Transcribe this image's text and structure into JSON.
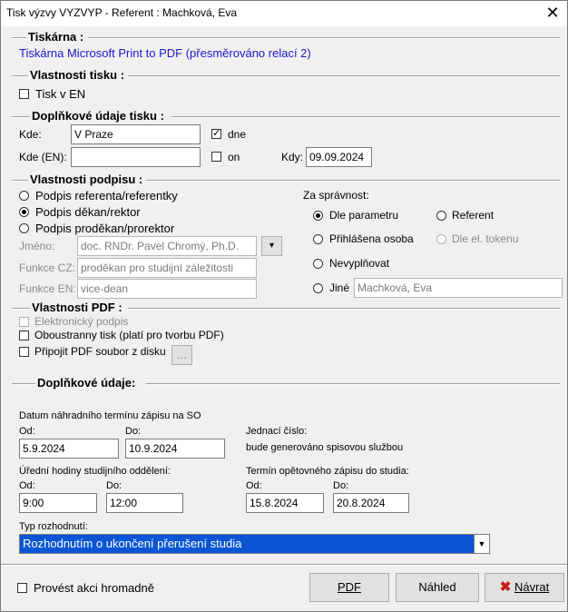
{
  "window": {
    "title": "Tisk výzvy VYZVYP - Referent : Machková, Eva"
  },
  "printer": {
    "heading": "Tiskárna :",
    "value": "Tiskárna Microsoft Print to PDF (přesměrováno relací 2)"
  },
  "print_props": {
    "heading": "Vlastnosti tisku :",
    "tisk_en": "Tisk v EN"
  },
  "extra_print": {
    "heading": "Doplňkové údaje tisku :",
    "kde_label": "Kde:",
    "kde_value": "V Praze",
    "dne_label": "dne",
    "kde_en_label": "Kde (EN):",
    "kde_en_value": "",
    "on_label": "on",
    "kdy_label": "Kdy:",
    "kdy_value": "09.09.2024"
  },
  "signature": {
    "heading": "Vlastnosti podpisu :",
    "options": [
      "Podpis referenta/referentky",
      "Podpis děkan/rektor",
      "Podpis proděkan/prorektor"
    ],
    "jmeno_label": "Jméno:",
    "jmeno_value": "doc. RNDr. Pavel Chromý, Ph.D.",
    "funkce_cz_label": "Funkce CZ:",
    "funkce_cz_value": "proděkan pro studijní záležitosti",
    "funkce_en_label": "Funkce EN:",
    "funkce_en_value": "vice-dean",
    "za_spravnost": "Za správnost:",
    "correct_options": [
      "Dle parametru",
      "Referent",
      "Přihlášena osoba",
      "Dle el. tokenu",
      "Nevyplňovat",
      "Jiné"
    ],
    "jine_value": "Machková, Eva"
  },
  "pdf": {
    "heading": "Vlastnosti PDF :",
    "el_podpis": "Elektronický podpis",
    "oboustranny": "Oboustranny tisk (platí pro tvorbu PDF)",
    "pripojit": "Připojit PDF soubor z disku",
    "browse": "..."
  },
  "extra": {
    "heading": "Doplňkové údaje:",
    "datum_label": "Datum náhradního termínu zápisu na SO",
    "od_label": "Od:",
    "do_label": "Do:",
    "datum_od": "5.9.2024",
    "datum_do": "10.9.2024",
    "jednaci_label": "Jednací číslo:",
    "jednaci_value": "bude generováno spisovou službou",
    "hodiny_label": "Úřední hodiny studijního oddělení:",
    "hodiny_od": "9:00",
    "hodiny_do": "12:00",
    "termin_label": "Termín opětovného zápisu do studia:",
    "termin_od": "15.8.2024",
    "termin_do": "20.8.2024",
    "typ_label": "Typ rozhodnutí:",
    "typ_value": "Rozhodnutím o ukončení přerušení studia"
  },
  "footer": {
    "hromadne": "Provést akci hromadně",
    "pdf_btn": "PDF",
    "nahled_btn": "Náhled",
    "navrat_btn": "Návrat"
  }
}
